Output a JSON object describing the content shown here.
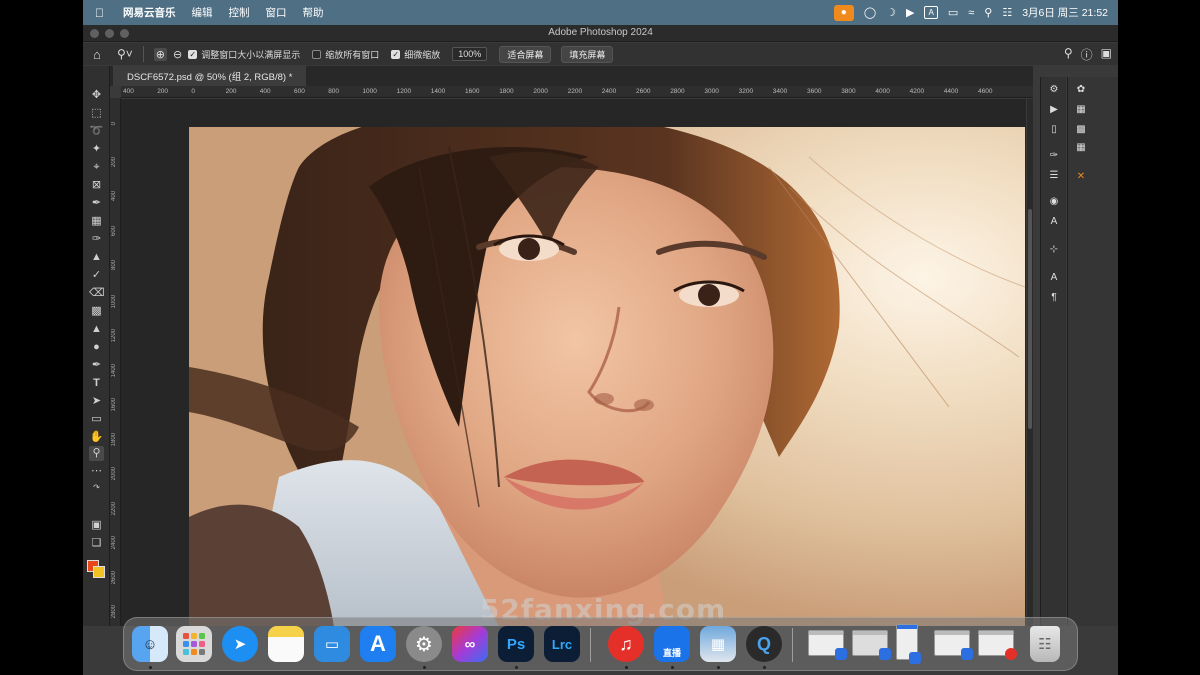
{
  "menubar": {
    "app_name": "网易云音乐",
    "items": [
      "编辑",
      "控制",
      "窗口",
      "帮助"
    ],
    "datetime": "3月6日 周三  21:52"
  },
  "window": {
    "title": "Adobe Photoshop 2024"
  },
  "options_bar": {
    "check_resize": "调整窗口大小以满屏显示",
    "check_zoom_all": "缩放所有窗口",
    "check_scrubby": "细微缩放",
    "zoom_value": "100%",
    "fit_screen": "适合屏幕",
    "fill_screen": "填充屏幕"
  },
  "document": {
    "tab_title": "DSCF6572.psd @ 50% (组 2, RGB/8) *"
  },
  "rulers": {
    "top": [
      "400",
      "200",
      "0",
      "200",
      "400",
      "600",
      "800",
      "1000",
      "1200",
      "1400",
      "1600",
      "1800",
      "2000",
      "2200",
      "2400",
      "2600",
      "2800",
      "3000",
      "3200",
      "3400",
      "3600",
      "3800",
      "4000",
      "4200",
      "4400",
      "4600"
    ],
    "left": [
      "0",
      "200",
      "400",
      "600",
      "800",
      "1000",
      "1200",
      "1400",
      "1600",
      "1800",
      "2000",
      "2200",
      "2400",
      "2600",
      "2800"
    ]
  },
  "colors": {
    "foreground": "#e8481a",
    "background": "#f1c126",
    "menubar": "#4f6f84"
  },
  "watermark": "52fanxing.com",
  "dock": {
    "apps": [
      "finder",
      "launchpad",
      "safari",
      "notes",
      "keynote",
      "app-store",
      "system-settings",
      "creative-cloud",
      "photoshop",
      "lightroom-classic",
      "netease-music",
      "live-app",
      "preview",
      "quicktime"
    ],
    "ps_label": "Ps",
    "lrc_label": "Lrc",
    "live_label": "直播"
  }
}
